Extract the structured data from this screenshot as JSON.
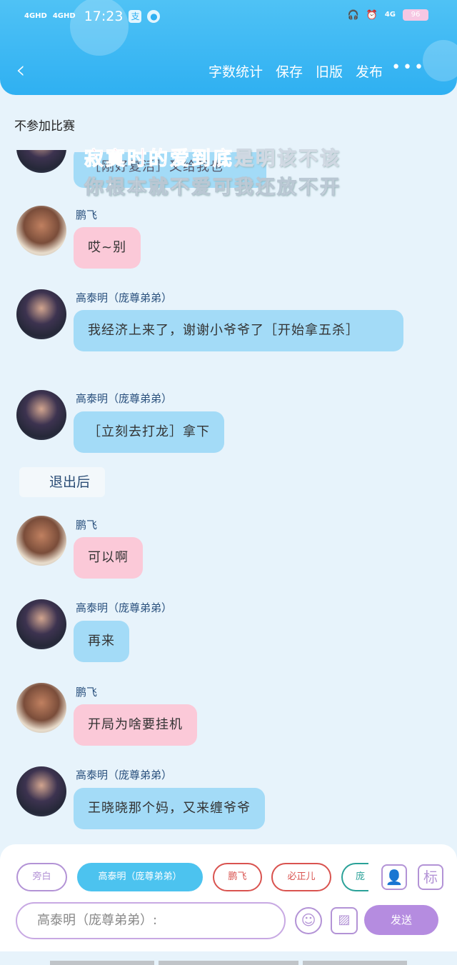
{
  "status_bar": {
    "signal1": "4GHD",
    "signal2": "4GHD",
    "time": "17:23",
    "network": "4G",
    "battery": "96"
  },
  "nav": {
    "back_icon": "chevron-left-icon",
    "actions": [
      "字数统计",
      "保存",
      "旧版",
      "发布"
    ],
    "more": "•••"
  },
  "notice": "不参加比赛",
  "lyrics": {
    "line1_highlight": "寂寞时的爱到底",
    "line1_rest": "是明该不该",
    "line2": "你根本就不爱可我还放不开"
  },
  "partial_message": "［刚好复活］又给我也",
  "messages": [
    {
      "name": "鹏飞",
      "text": "哎~别"
    },
    {
      "name": "高泰明（庞尊弟弟）",
      "text": "我经济上来了，谢谢小爷爷了［开始拿五杀］"
    },
    {
      "name": "高泰明（庞尊弟弟）",
      "text": "［立刻去打龙］拿下"
    },
    {
      "name": "鹏飞",
      "text": "可以啊"
    },
    {
      "name": "高泰明（庞尊弟弟）",
      "text": "再来"
    },
    {
      "name": "鹏飞",
      "text": "开局为啥要挂机"
    },
    {
      "name": "高泰明（庞尊弟弟）",
      "text": "王晓晓那个妈，又来缠爷爷"
    }
  ],
  "narration": "退出后",
  "bottom": {
    "chips": [
      "旁白",
      "高泰明（庞尊弟弟）",
      "鹏飞",
      "必正儿",
      "庞"
    ],
    "input_placeholder": "高泰明（庞尊弟弟）:",
    "send_label": "发送",
    "mark_label": "标"
  }
}
